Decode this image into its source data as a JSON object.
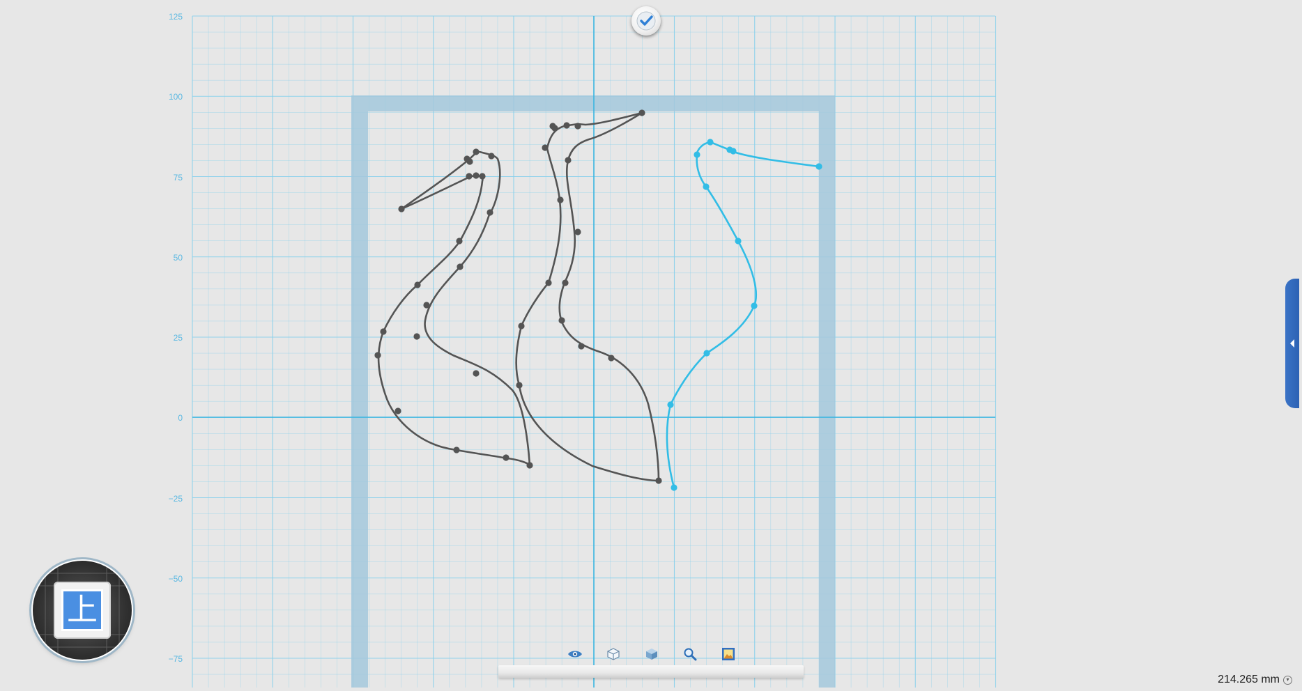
{
  "canvas": {
    "axis_labels_y": [
      "125",
      "100",
      "75",
      "50",
      "25",
      "0",
      "−25",
      "−50",
      "−75"
    ],
    "grid_color": "#88d0ec",
    "axis_color": "#33b4e0",
    "frame_color": "#a3c8dc"
  },
  "sketch": {
    "curve_color_default": "#545454",
    "curve_color_selected": "#32bde6"
  },
  "done_button": {
    "icon": "checkmark-icon"
  },
  "view_cube": {
    "face_label": "上"
  },
  "toolbar": {
    "items": [
      {
        "name": "eye-icon"
      },
      {
        "name": "wireframe-cube-icon"
      },
      {
        "name": "solid-cube-icon"
      },
      {
        "name": "zoom-icon"
      },
      {
        "name": "frame-image-icon"
      }
    ]
  },
  "side_panel": {
    "icon": "collapse-arrow-icon"
  },
  "status": {
    "measurement": "214.265 mm"
  }
}
